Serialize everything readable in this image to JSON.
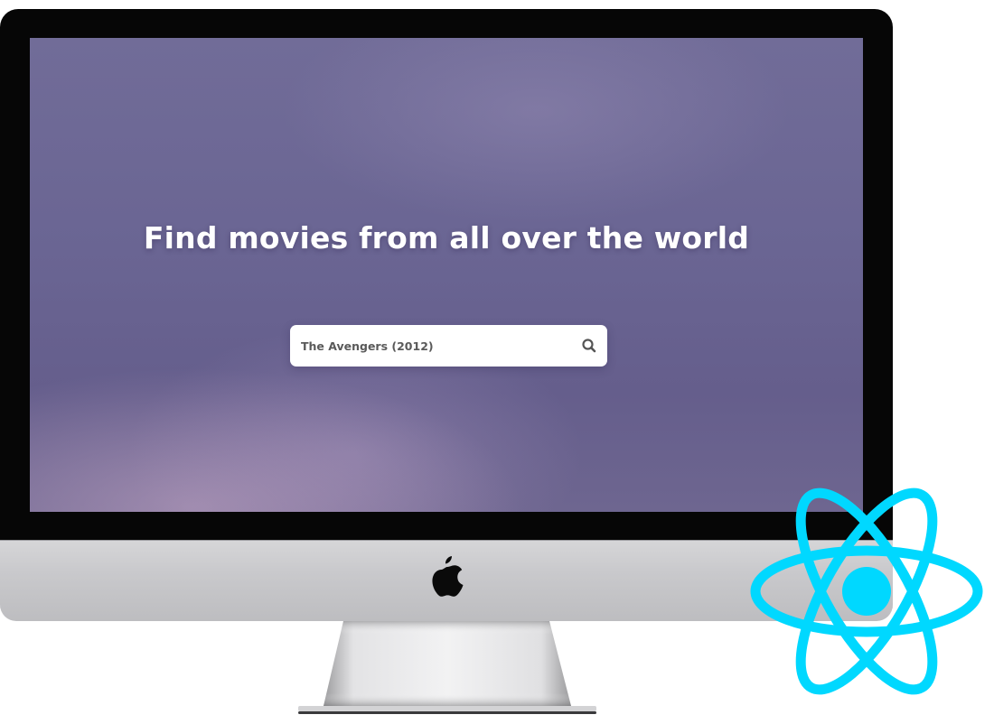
{
  "screen": {
    "headline": "Find movies from all over the world"
  },
  "search": {
    "value": "The Avengers (2012)"
  },
  "icons": {
    "search": "search-icon",
    "apple": "apple-logo-icon",
    "react": "react-logo-icon"
  },
  "colors": {
    "react_blue": "#00d8ff",
    "screen_base": "#6a6593",
    "bezel": "#060606",
    "chin": "#c9c9cc"
  }
}
